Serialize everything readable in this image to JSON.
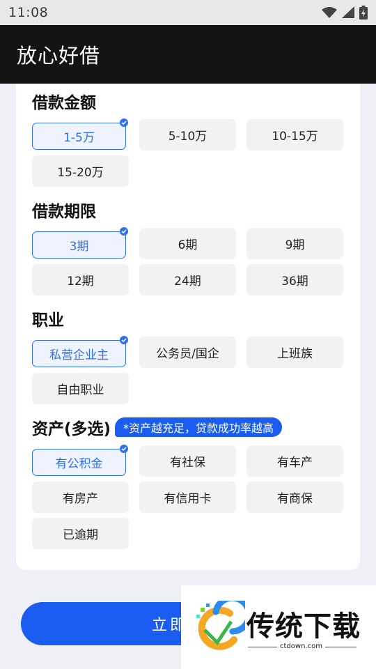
{
  "status": {
    "time": "11:08"
  },
  "app": {
    "title": "放心好借"
  },
  "sections": {
    "amount": {
      "title": "借款金额",
      "options": [
        "1-5万",
        "5-10万",
        "10-15万",
        "15-20万"
      ],
      "selected": "1-5万"
    },
    "term": {
      "title": "借款期限",
      "options": [
        "3期",
        "6期",
        "9期",
        "12期",
        "24期",
        "36期"
      ],
      "selected": "3期"
    },
    "job": {
      "title": "职业",
      "options": [
        "私营企业主",
        "公务员/国企",
        "上班族",
        "自由职业"
      ],
      "selected": "私营企业主"
    },
    "assets": {
      "title": "资产(多选)",
      "hint": "*资产越充足，贷款成功率越高",
      "options": [
        "有公积金",
        "有社保",
        "有车产",
        "有房产",
        "有信用卡",
        "有商保",
        "已逾期"
      ],
      "selected": "有公积金"
    }
  },
  "apply": {
    "label": "立即申请"
  },
  "watermark": {
    "brand": "传统下载",
    "domain": "ctdown.com"
  },
  "colors": {
    "accent": "#2f6ff0",
    "button": "#1a5cf0",
    "appbar": "#141414"
  }
}
